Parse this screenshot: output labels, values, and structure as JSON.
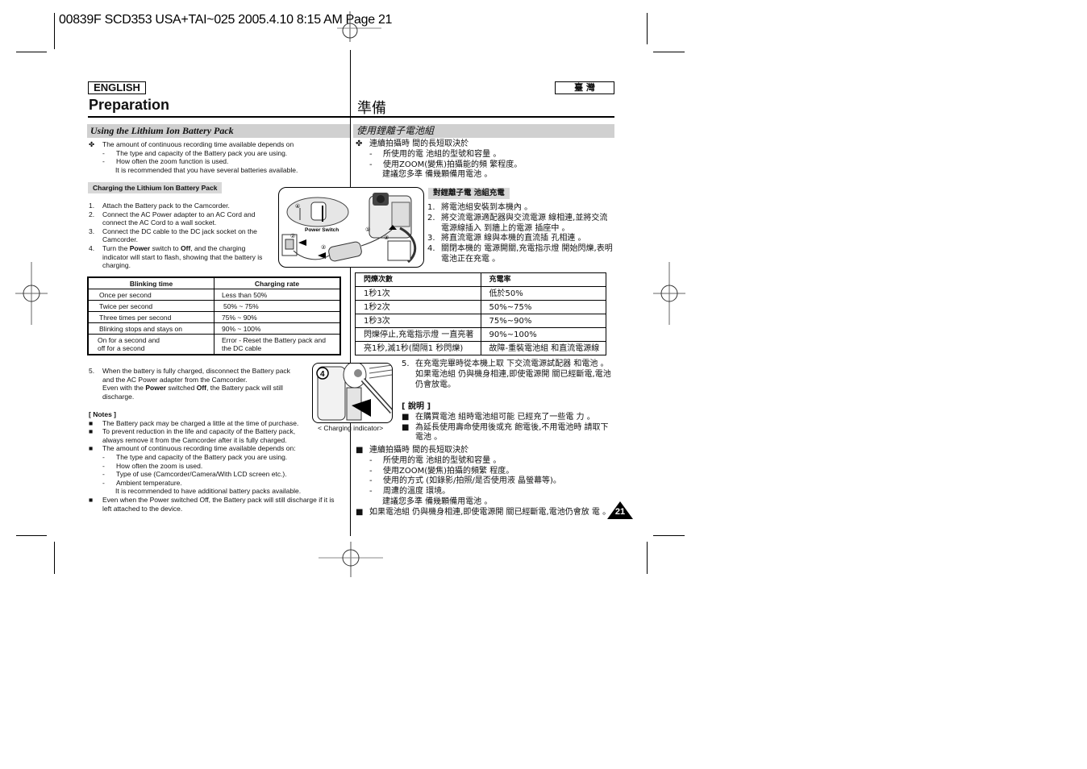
{
  "slug": "00839F SCD353 USA+TAI~025  2005.4.10  8:15 AM  Page 21",
  "left": {
    "lang_label": "ENGLISH",
    "title": "Preparation",
    "section_title": "Using the Lithium Ion Battery Pack",
    "intro": {
      "bullet": "The amount of continuous recording time available depends on",
      "items": [
        "The type and capacity of the Battery pack you are using.",
        "How often the zoom function is used."
      ],
      "tail": "It is recommended that you have several batteries available."
    },
    "subsection_title": "Charging the Lithium Ion Battery Pack",
    "steps": [
      {
        "num": "1.",
        "lines": [
          "Attach the Battery pack to the Camcorder."
        ]
      },
      {
        "num": "2.",
        "lines": [
          "Connect the AC Power adapter to an AC Cord and",
          "connect the AC Cord to a wall socket."
        ]
      },
      {
        "num": "3.",
        "lines": [
          "Connect the DC cable to the DC jack socket on the",
          "Camcorder."
        ]
      }
    ],
    "step4": {
      "num": "4.",
      "pre": "Turn the ",
      "b1": "Power",
      "mid": " switch to ",
      "b2": "Off",
      "post": ", and the charging",
      "line2": "indicator will start to flash, showing that the battery is",
      "line3": "charging."
    },
    "illustration": {
      "power_switch_label": "Power Switch",
      "markers": [
        "④",
        "①",
        "②",
        "②",
        "③"
      ]
    },
    "table": {
      "headers": [
        "Blinking time",
        "Charging rate"
      ],
      "rows": [
        [
          "Once per second",
          "Less than 50%"
        ],
        [
          "Twice per second",
          "50% ~ 75%"
        ],
        [
          "Three times per second",
          "75%  ~  90%"
        ],
        [
          "Blinking stops and stays on",
          "90% ~ 100%"
        ],
        [
          "On for a second and\noff for a second",
          "Error - Reset the Battery pack and\nthe DC cable"
        ]
      ]
    },
    "step5": {
      "num": "5.",
      "line1": "When the battery is fully charged, disconnect the Battery pack",
      "line2": "and the AC Power adapter from the Camcorder.",
      "line3_pre": "Even with the ",
      "line3_b1": "Power",
      "line3_mid": " switched ",
      "line3_b2": "Off",
      "line3_post": ", the Battery pack will still",
      "line4": "discharge."
    },
    "notes_title": "[ Notes ]",
    "notes": [
      {
        "lines": [
          "The Battery pack may be charged a little at the time of purchase."
        ]
      },
      {
        "lines": [
          "To prevent reduction in the life and capacity of the Battery pack,",
          "always remove it from the Camcorder after it is fully charged."
        ]
      },
      {
        "lines": [
          "The amount of continuous recording time available depends on:"
        ],
        "sub": [
          "The type and capacity of the Battery pack you are using.",
          "How often the zoom is used.",
          "Type of use (Camcorder/Camera/With LCD screen etc.).",
          "Ambient temperature."
        ],
        "tail": "It is recommended to have additional battery packs available."
      },
      {
        "lines": [
          "Even when the Power switched Off, the Battery pack will still discharge if it is",
          "left attached to the device."
        ]
      }
    ],
    "indicator_caption": "< Charging indicator>",
    "indicator_marker": "4"
  },
  "right": {
    "lang_label": "臺  灣",
    "title": "準備",
    "section_title": "使用鋰離子電池組",
    "intro": {
      "bullet": "連續拍攝時 間的長短取決於",
      "items": [
        "所使用的電 池組的型號和容量 。",
        "使用ZOOM(變焦)拍攝能的頻 繁程度。"
      ],
      "tail": "建議您多準 備幾顆備用電池 。"
    },
    "subsection_title": "對鋰離子電 池組充電",
    "steps": [
      {
        "num": "1.",
        "lines": [
          "將電池組安裝到本機內 。"
        ]
      },
      {
        "num": "2.",
        "lines": [
          "將交流電源適配器與交流電源 線相連,並將交流",
          "電源線插入 到牆上的電源 插座中 。"
        ]
      },
      {
        "num": "3.",
        "lines": [
          "將直流電源 線與本機的直流插 孔相連 。"
        ]
      },
      {
        "num": "4.",
        "lines": [
          "關閉本機的 電源開關,充電指示燈 開始閃爍,表明",
          "電池正在充電 。"
        ]
      }
    ],
    "table": {
      "headers": [
        "閃爍次數",
        "充電率"
      ],
      "rows": [
        [
          "1秒1次",
          "低於50%"
        ],
        [
          "1秒2次",
          "50%~75%"
        ],
        [
          "1秒3次",
          "75%~90%"
        ],
        [
          "閃爍停止,充電指示燈 一直亮著",
          "90%~100%"
        ],
        [
          "亮1秒,滅1秒(間隔1 秒閃爍)",
          "故障-重裝電池組 和直流電源線"
        ]
      ]
    },
    "step5": {
      "num": "5.",
      "lines": [
        "在充電完畢時從本機上取 下交流電源試配器 和電池 。",
        "如果電池組 仍與機身相連,即使電源開 關已經斷電,電池",
        "仍會放電。"
      ]
    },
    "notes_title": "[ 說明 ]",
    "notes": [
      {
        "lines": [
          "在購買電池 組時電池組可能 已經充了一些電 力 。"
        ]
      },
      {
        "lines": [
          "為延長使用壽命使用後或充 飽電後,不用電池時 請取下",
          "電池 。"
        ]
      },
      {
        "lines": [
          "連續拍攝時 間的長短取決於"
        ],
        "sub": [
          "所使用的電 池組的型號和容量 。",
          "使用ZOOM(變焦)拍攝的頻繁 程度。",
          "使用的方式 (如錄影/拍照/是否使用液 晶螢幕等)。",
          "周遭的溫度 環境。"
        ],
        "tail": "建議您多準 備幾顆備用電池 。"
      },
      {
        "lines": [
          "如果電池組 仍與機身相連,即使電源開 關已經斷電,電池仍會放 電 。"
        ]
      }
    ]
  },
  "page_number": "21",
  "icons": {
    "bullet_cross": "✤",
    "bullet_square": "■",
    "dash": "-"
  }
}
